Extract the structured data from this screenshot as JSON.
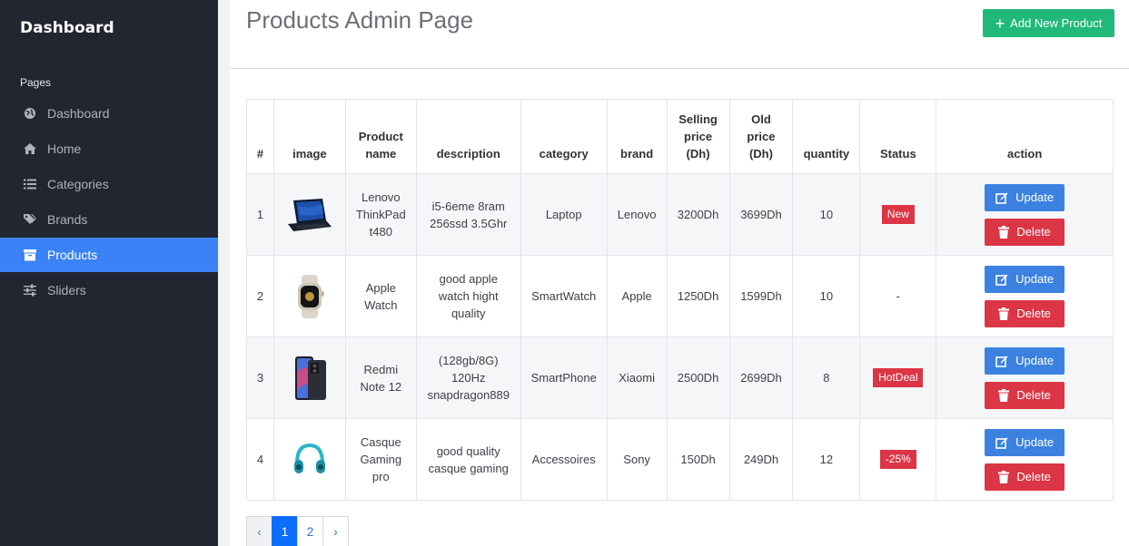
{
  "sidebar": {
    "brand": "Dashboard",
    "section_title": "Pages",
    "items": [
      {
        "label": "Dashboard",
        "icon": "globe-icon"
      },
      {
        "label": "Home",
        "icon": "home-icon"
      },
      {
        "label": "Categories",
        "icon": "list-icon"
      },
      {
        "label": "Brands",
        "icon": "tags-icon"
      },
      {
        "label": "Products",
        "icon": "box-icon",
        "active": true
      },
      {
        "label": "Sliders",
        "icon": "sliders-icon"
      }
    ]
  },
  "header": {
    "title": "Products Admin Page",
    "add_button": "Add New Product"
  },
  "table": {
    "columns": [
      "#",
      "image",
      "Product name",
      "description",
      "category",
      "brand",
      "Selling price (Dh)",
      "Old price (Dh)",
      "quantity",
      "Status",
      "action"
    ],
    "rows": [
      {
        "num": "1",
        "image": "laptop-image",
        "name": "Lenovo ThinkPad t480",
        "description": "i5-6eme 8ram 256ssd 3.5Ghr",
        "category": "Laptop",
        "brand": "Lenovo",
        "selling": "3200Dh",
        "old": "3699Dh",
        "quantity": "10",
        "status": "New"
      },
      {
        "num": "2",
        "image": "watch-image",
        "name": "Apple Watch",
        "description": "good apple watch hight quality",
        "category": "SmartWatch",
        "brand": "Apple",
        "selling": "1250Dh",
        "old": "1599Dh",
        "quantity": "10",
        "status": "-"
      },
      {
        "num": "3",
        "image": "phone-image",
        "name": "Redmi Note 12",
        "description": "(128gb/8G) 120Hz snapdragon889",
        "category": "SmartPhone",
        "brand": "Xiaomi",
        "selling": "2500Dh",
        "old": "2699Dh",
        "quantity": "8",
        "status": "HotDeal"
      },
      {
        "num": "4",
        "image": "headphones-image",
        "name": "Casque Gaming pro",
        "description": "good quality casque gaming",
        "category": "Accessoires",
        "brand": "Sony",
        "selling": "150Dh",
        "old": "249Dh",
        "quantity": "12",
        "status": "-25%"
      }
    ],
    "update_label": "Update",
    "delete_label": "Delete"
  },
  "pagination": {
    "prev": "‹",
    "pages": [
      "1",
      "2"
    ],
    "next": "›",
    "current": "1"
  },
  "colors": {
    "sidebar_bg": "#212631",
    "active_nav": "#3b82f6",
    "add_button": "#20b97a",
    "update_button": "#3b82e0",
    "delete_button": "#dc3545",
    "badge": "#dc3545"
  }
}
